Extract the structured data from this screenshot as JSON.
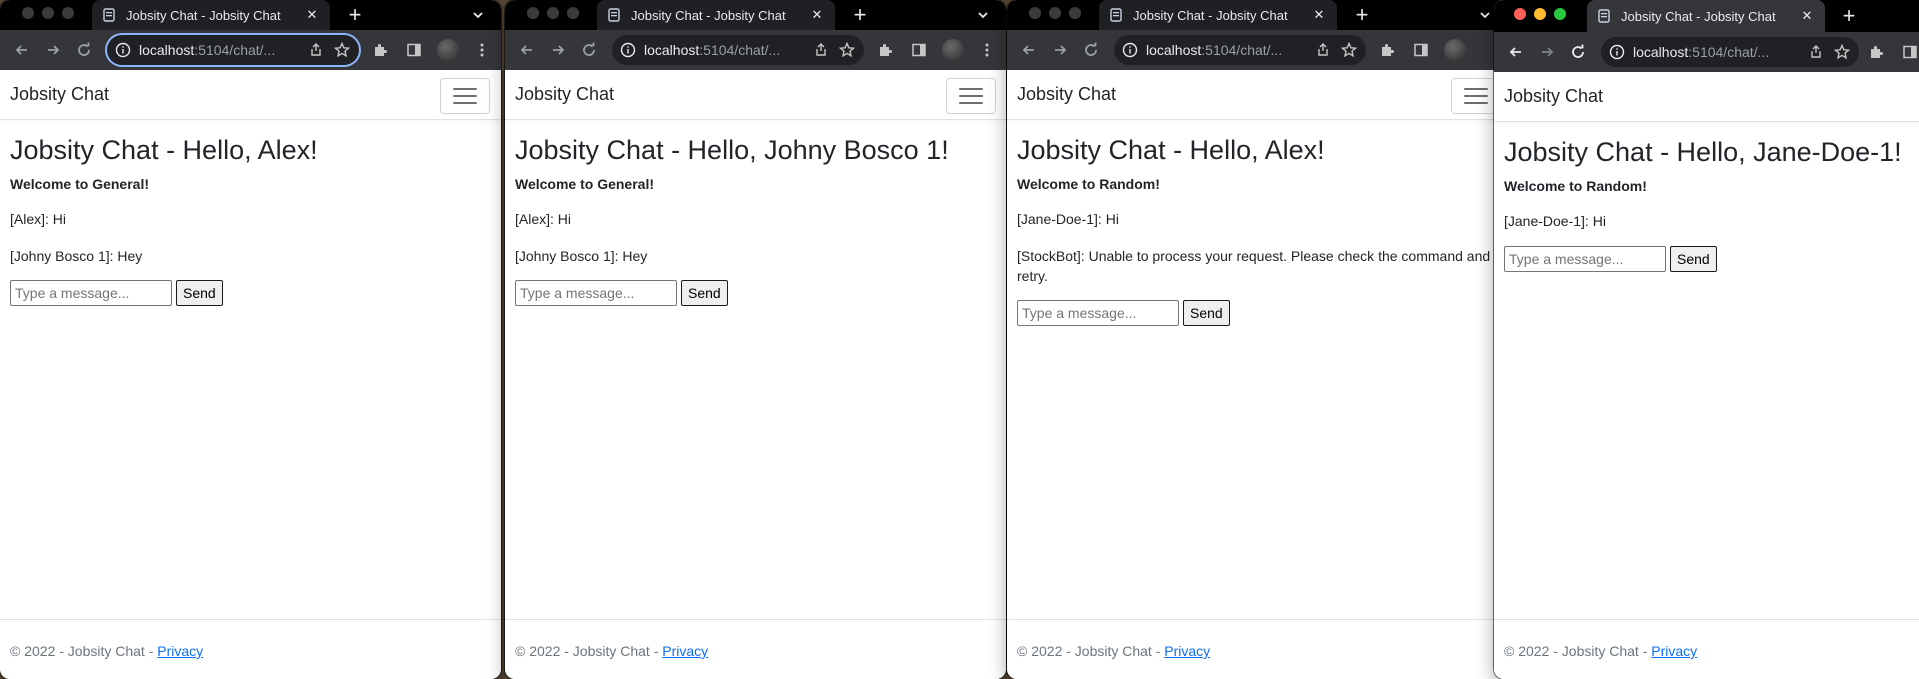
{
  "windows": [
    {
      "tab_title": "Jobsity Chat - Jobsity Chat",
      "url_host": "localhost",
      "url_path": ":5104/chat/...",
      "brand": "Jobsity Chat",
      "heading": "Jobsity Chat - Hello, Alex!",
      "welcome": "Welcome to General!",
      "messages": [
        "[Alex]: Hi",
        "[Johny Bosco 1]: Hey"
      ],
      "input_placeholder": "Type a message...",
      "send_label": "Send",
      "footer_text": "© 2022 - Jobsity Chat -",
      "footer_link": "Privacy"
    },
    {
      "tab_title": "Jobsity Chat - Jobsity Chat",
      "url_host": "localhost",
      "url_path": ":5104/chat/...",
      "brand": "Jobsity Chat",
      "heading": "Jobsity Chat - Hello, Johny Bosco 1!",
      "welcome": "Welcome to General!",
      "messages": [
        "[Alex]: Hi",
        "[Johny Bosco 1]: Hey"
      ],
      "input_placeholder": "Type a message...",
      "send_label": "Send",
      "footer_text": "© 2022 - Jobsity Chat -",
      "footer_link": "Privacy"
    },
    {
      "tab_title": "Jobsity Chat - Jobsity Chat",
      "url_host": "localhost",
      "url_path": ":5104/chat/...",
      "brand": "Jobsity Chat",
      "heading": "Jobsity Chat - Hello, Alex!",
      "welcome": "Welcome to Random!",
      "messages": [
        "[Jane-Doe-1]: Hi",
        "[StockBot]: Unable to process your request. Please check the command and retry."
      ],
      "input_placeholder": "Type a message...",
      "send_label": "Send",
      "footer_text": "© 2022 - Jobsity Chat -",
      "footer_link": "Privacy"
    },
    {
      "tab_title": "Jobsity Chat - Jobsity Chat",
      "url_host": "localhost",
      "url_path": ":5104/chat/...",
      "brand": "Jobsity Chat",
      "heading": "Jobsity Chat - Hello, Jane-Doe-1!",
      "welcome": "Welcome to Random!",
      "messages": [
        "[Jane-Doe-1]: Hi"
      ],
      "input_placeholder": "Type a message...",
      "send_label": "Send",
      "footer_text": "© 2022 - Jobsity Chat -",
      "footer_link": "Privacy"
    }
  ],
  "colors": {
    "link": "#0d6efd",
    "focus_ring": "#8ab4f8",
    "mac_red": "#ff5f57",
    "mac_yellow": "#febc2e",
    "mac_green": "#28c840"
  }
}
